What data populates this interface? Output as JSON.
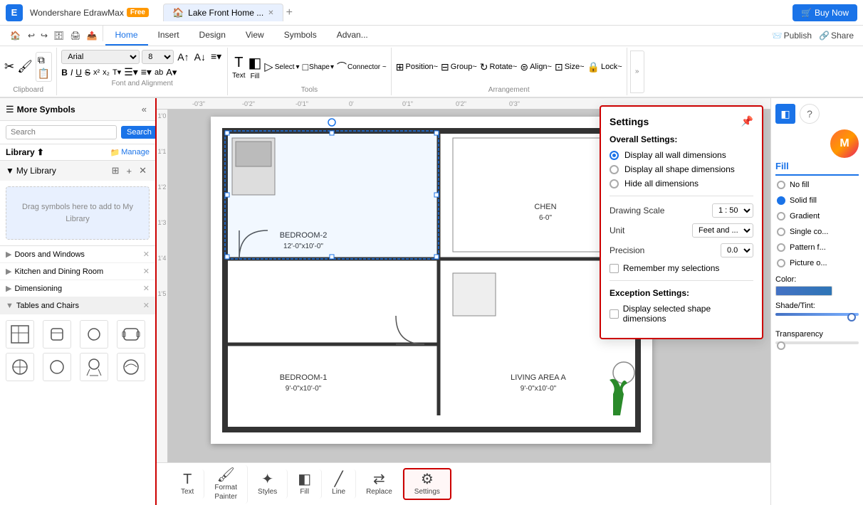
{
  "app": {
    "logo": "E",
    "name": "Wondershare EdrawMax",
    "free_badge": "Free",
    "tab_title": "Lake Front Home ...",
    "buy_now": "Buy Now"
  },
  "ribbon_tabs": [
    {
      "label": "Home",
      "active": true
    },
    {
      "label": "Insert"
    },
    {
      "label": "Design"
    },
    {
      "label": "View"
    },
    {
      "label": "Symbols"
    },
    {
      "label": "Advan..."
    }
  ],
  "toolbar": {
    "clipboard_label": "Clipboard",
    "font_alignment_label": "Font and Alignment",
    "tools_label": "Tools",
    "arrangement_label": "Arrangement",
    "font": "Arial",
    "font_size": "8",
    "select_btn": "Select",
    "shape_btn": "Shape",
    "connector_btn": "Connector ~",
    "text_btn": "Text",
    "fill_btn": "Fill",
    "format_painter_btn": "Format Painter",
    "styles_btn": "Styles",
    "line_btn": "Line",
    "replace_btn": "Replace",
    "settings_btn": "Settings",
    "position_btn": "Position~",
    "group_btn": "Group~",
    "rotate_btn": "Rotate~",
    "align_btn": "Align~",
    "size_btn": "Size~",
    "lock_btn": "Lock~",
    "publish_btn": "Publish",
    "share_btn": "Share"
  },
  "sidebar": {
    "title": "More Symbols",
    "search_placeholder": "Search",
    "search_btn": "Search",
    "library_label": "Library",
    "manage_btn": "Manage",
    "my_library_title": "My Library",
    "drag_hint": "Drag symbols here to add to My Library",
    "categories": [
      {
        "name": "Doors and Windows"
      },
      {
        "name": "Kitchen and Dining Room"
      },
      {
        "name": "Dimensioning"
      },
      {
        "name": "Tables and Chairs"
      }
    ]
  },
  "settings": {
    "title": "Settings",
    "overall_title": "Overall Settings:",
    "options": [
      {
        "label": "Display all wall dimensions",
        "selected": true
      },
      {
        "label": "Display all shape dimensions",
        "selected": false
      },
      {
        "label": "Hide all dimensions",
        "selected": false
      }
    ],
    "drawing_scale_label": "Drawing Scale",
    "drawing_scale_value": "1 : 50",
    "unit_label": "Unit",
    "unit_value": "Feet and ...",
    "precision_label": "Precision",
    "precision_value": "0.0",
    "remember_label": "Remember my selections",
    "exception_title": "Exception Settings:",
    "exception_option": "Display selected shape dimensions"
  },
  "right_panel": {
    "title": "Fill",
    "options": [
      {
        "label": "No fill"
      },
      {
        "label": "Solid fill",
        "selected": true
      },
      {
        "label": "Gradient"
      },
      {
        "label": "Single co..."
      },
      {
        "label": "Pattern f..."
      },
      {
        "label": "Picture o..."
      }
    ],
    "color_label": "Color:",
    "shade_label": "Shade/Tint:",
    "transparency_label": "Transparency"
  },
  "bottom_toolbar": [
    {
      "label": "Text",
      "icon": "T",
      "active": false
    },
    {
      "label": "Format\nPainter",
      "icon": "🖌",
      "active": false
    },
    {
      "label": "Styles",
      "icon": "✦",
      "active": false
    },
    {
      "label": "Fill",
      "icon": "◧",
      "active": false
    },
    {
      "label": "Line",
      "icon": "╱",
      "active": false
    },
    {
      "label": "Replace",
      "icon": "⇄",
      "active": false
    },
    {
      "label": "Settings",
      "icon": "⚙",
      "active": true
    }
  ],
  "canvas": {
    "bedroom2_label": "BEDROOM-2",
    "bedroom2_dim": "12'-0\"x10'-0\"",
    "bedroom1_label": "BEDROOM-1",
    "bedroom1_dim": "9'-0\"x10'-0\"",
    "living_label": "LIVING AREA A",
    "living_dim": "9'-0\"x10'-0\"",
    "kitchen_label": "CHEN",
    "kitchen_dim": "6-0\""
  }
}
